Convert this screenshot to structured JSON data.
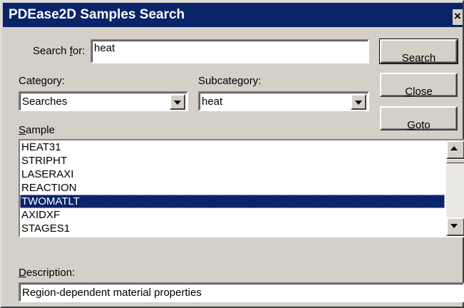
{
  "window": {
    "title": "PDEase2D Samples Search",
    "close_glyph": "×"
  },
  "search": {
    "label_prefix": "Search ",
    "label_accel": "f",
    "label_suffix": "or:",
    "value": "heat"
  },
  "category": {
    "label": "Category:",
    "value": "Searches"
  },
  "subcategory": {
    "label": "Subcategory:",
    "value": "heat"
  },
  "buttons": {
    "search": {
      "pre": "Sea",
      "accel": "r",
      "post": "ch"
    },
    "close": {
      "pre": "",
      "accel": "C",
      "post": "lose"
    },
    "goto": {
      "pre": "",
      "accel": "G",
      "post": "oto"
    }
  },
  "sample": {
    "label_accel": "S",
    "label_rest": "ample",
    "items": [
      "HEAT31",
      "STRIPHT",
      "LASERAXI",
      "REACTION",
      "TWOMATLT",
      "AXIDXF",
      "STAGES1"
    ],
    "selected": "TWOMATLT"
  },
  "description": {
    "label_accel": "D",
    "label_rest": "escription:",
    "value": "Region-dependent material properties"
  },
  "colors": {
    "titlebar": "#0a246a",
    "face": "#d4d0c8",
    "selection": "#0a246a"
  }
}
